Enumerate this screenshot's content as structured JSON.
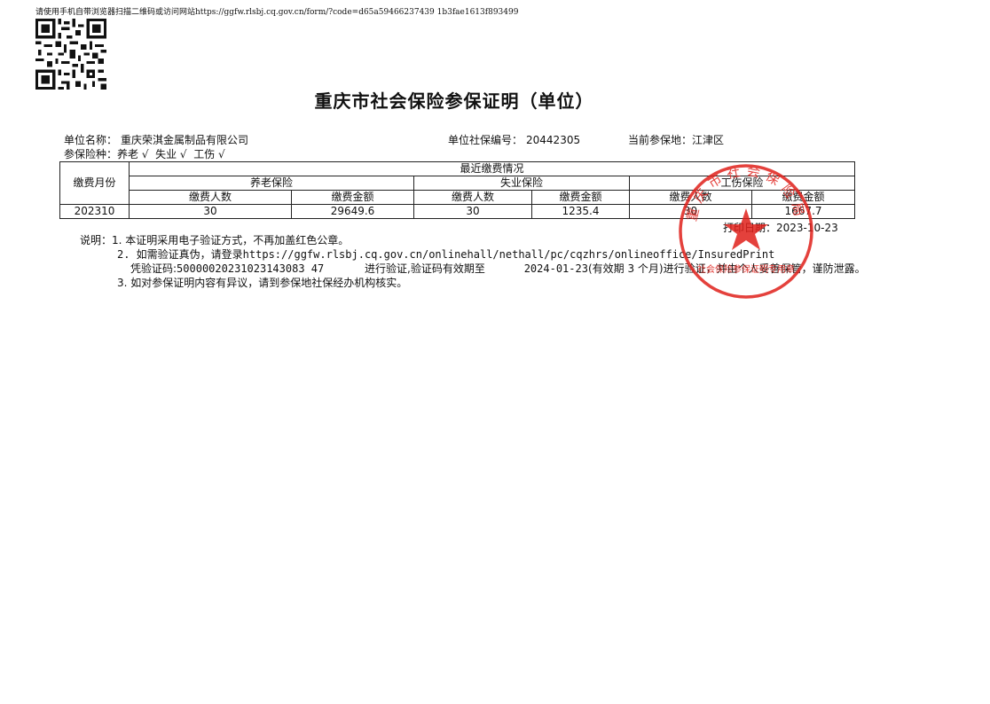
{
  "top_notice": "请使用手机自带浏览器扫描二维码或访问网站https://ggfw.rlsbj.cq.gov.cn/form/?code=d65a59466237439 1b3fae1613f893499",
  "title": "重庆市社会保险参保证明（单位）",
  "unit": {
    "name_label": "单位名称：",
    "name": "重庆荣淇金属制品有限公司",
    "code_label": "单位社保编号：",
    "code": "20442305",
    "location_label": "当前参保地：",
    "location": "江津区"
  },
  "insurance_types": {
    "label": "参保险种：",
    "items": "养老 √  失业 √  工伤 √"
  },
  "table": {
    "month_header": "缴费月份",
    "group_header": "最近缴费情况",
    "pension": "养老保险",
    "unemployment": "失业保险",
    "injury": "工伤保险",
    "people": "缴费人数",
    "amount": "缴费金额",
    "rows": [
      {
        "month": "202310",
        "p_people": "30",
        "p_amount": "29649.6",
        "u_people": "30",
        "u_amount": "1235.4",
        "i_people": "30",
        "i_amount": "1667.7"
      }
    ]
  },
  "print_date": {
    "label": "打印日期：",
    "value": "2023-10-23"
  },
  "notes": {
    "label": "说明：",
    "n1": "1. 本证明采用电子验证方式，不再加盖红色公章。",
    "n2": "2. 如需验证真伪，请登录https://ggfw.rlsbj.cq.gov.cn/onlinehall/nethall/pc/cqzhrs/onlineoffice/InsuredPrint",
    "n2b_prefix": "凭验证码:",
    "verify_code": "50000020231023143083 47",
    "n2b_mid": "进行验证,验证码有效期至",
    "expiry": "2024-01-23",
    "n2b_suffix": "(有效期 3 个月)进行验证，并由个人妥善保管，谨防泄露。",
    "n3": "3. 如对参保证明内容有异议，请到参保地社保经办机构核实。"
  },
  "seal": {
    "text": "重庆市社会保险局",
    "bottom_text": "社会保险参保证明专用章",
    "color": "#e0201b"
  }
}
